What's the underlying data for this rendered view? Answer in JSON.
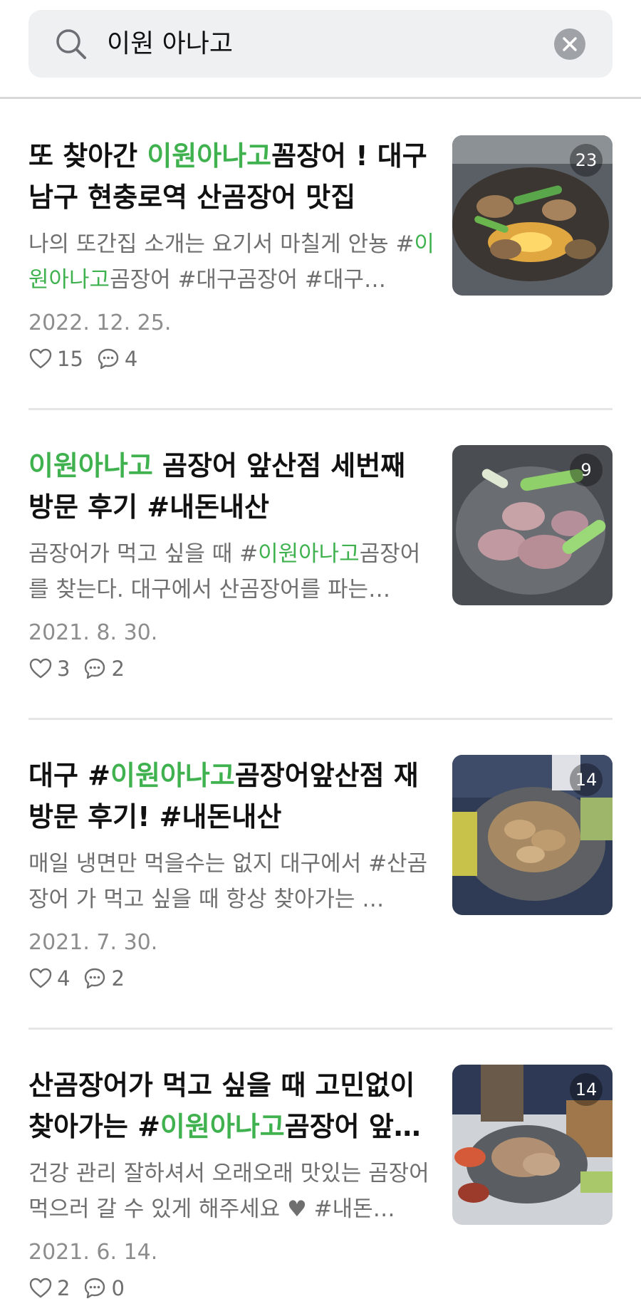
{
  "search": {
    "query": "이원 아나고"
  },
  "posts": [
    {
      "title": [
        {
          "t": "또 찾아간 ",
          "hl": false
        },
        {
          "t": "이원아나고",
          "hl": true
        },
        {
          "t": "꼼장어 ! 대구 남구 현충로역 산곰장어 맛집",
          "hl": false
        }
      ],
      "snippet": [
        {
          "t": "나의 또간집 소개는 요기서 마칠게 안뇽 #",
          "hl": false
        },
        {
          "t": "이원아나고",
          "hl": true
        },
        {
          "t": "곰장어 #대구곰장어 #대구…",
          "hl": false
        }
      ],
      "date": "2022. 12. 25.",
      "likes": "15",
      "comments": "4",
      "photo_count": "23"
    },
    {
      "title": [
        {
          "t": "이원아나고",
          "hl": true
        },
        {
          "t": " 곰장어 앞산점 세번째 방문 후기 #내돈내산",
          "hl": false
        }
      ],
      "snippet": [
        {
          "t": "곰장어가 먹고 싶을 때 #",
          "hl": false
        },
        {
          "t": "이원아나고",
          "hl": true
        },
        {
          "t": "곰장어 를 찾는다. 대구에서 산곰장어를 파는…",
          "hl": false
        }
      ],
      "date": "2021. 8. 30.",
      "likes": "3",
      "comments": "2",
      "photo_count": "9"
    },
    {
      "title": [
        {
          "t": "대구 #",
          "hl": false
        },
        {
          "t": "이원아나고",
          "hl": true
        },
        {
          "t": "곰장어앞산점 재방문 후기! #내돈내산",
          "hl": false
        }
      ],
      "snippet": [
        {
          "t": "매일 냉면만 먹을수는 없지 대구에서 #산곰장어 가 먹고 싶을 때 항상 찾아가는 …",
          "hl": false
        }
      ],
      "date": "2021. 7. 30.",
      "likes": "4",
      "comments": "2",
      "photo_count": "14"
    },
    {
      "title": [
        {
          "t": "산곰장어가 먹고 싶을 때 고민없이 찾아가는 #",
          "hl": false
        },
        {
          "t": "이원아나고",
          "hl": true
        },
        {
          "t": "곰장어 앞…",
          "hl": false
        }
      ],
      "snippet": [
        {
          "t": "건강 관리 잘하셔서 오래오래 맛있는 곰장어 먹으러 갈 수 있게 해주세요 ♥ #내돈…",
          "hl": false
        }
      ],
      "date": "2021. 6. 14.",
      "likes": "2",
      "comments": "0",
      "photo_count": "14"
    }
  ],
  "icons": {
    "search": "search-icon",
    "clear": "clear-icon",
    "like": "heart-icon",
    "comment": "comment-icon"
  },
  "colors": {
    "highlight": "#3fb24f",
    "search_bg": "#eef0f2",
    "muted_text": "#6f6f6f"
  }
}
